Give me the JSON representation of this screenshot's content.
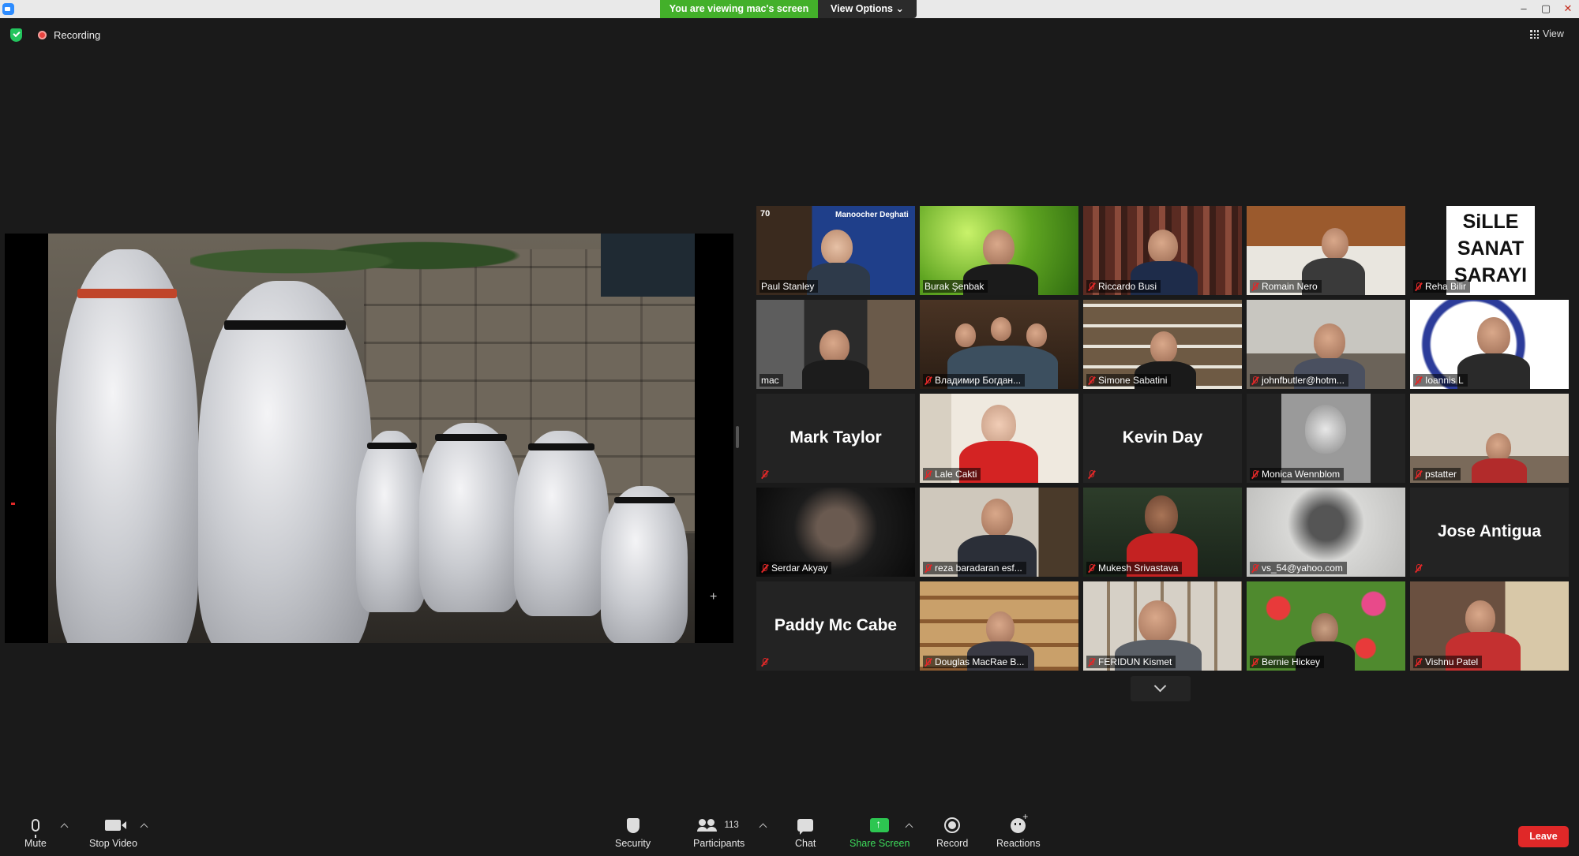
{
  "window": {
    "banner": "You are viewing mac's screen",
    "view_options": "View Options ⌄",
    "controls": [
      "–",
      "▢",
      "✕"
    ]
  },
  "meeting_bar": {
    "recording_label": "Recording",
    "view_label": "View"
  },
  "gallery": {
    "tiles": [
      {
        "name": "Paul Stanley",
        "video": true,
        "muted": false
      },
      {
        "name": "Burak Şenbak",
        "video": true,
        "muted": false
      },
      {
        "name": "Riccardo Busi",
        "video": true,
        "muted": true
      },
      {
        "name": "Romain Nero",
        "video": true,
        "muted": true
      },
      {
        "name": "Reha Bilir",
        "video": true,
        "muted": true
      },
      {
        "name": "mac",
        "video": true,
        "muted": false,
        "active": true
      },
      {
        "name": "Владимир Богдан...",
        "video": true,
        "muted": true
      },
      {
        "name": "Simone Sabatini",
        "video": true,
        "muted": true
      },
      {
        "name": "johnfbutler@hotm...",
        "video": true,
        "muted": true
      },
      {
        "name": "Ioannis L",
        "video": true,
        "muted": true
      },
      {
        "name": "Mark Taylor",
        "video": false,
        "muted": true
      },
      {
        "name": "Lale Cakti",
        "video": true,
        "muted": true
      },
      {
        "name": "Kevin Day",
        "video": false,
        "muted": true
      },
      {
        "name": "Monica Wennblom",
        "video": true,
        "muted": true
      },
      {
        "name": "pstatter",
        "video": true,
        "muted": true
      },
      {
        "name": "Serdar Akyay",
        "video": true,
        "muted": true
      },
      {
        "name": "reza baradaran esf...",
        "video": true,
        "muted": true
      },
      {
        "name": "Mukesh Srivastava",
        "video": true,
        "muted": true
      },
      {
        "name": "vs_54@yahoo.com",
        "video": true,
        "muted": true
      },
      {
        "name": "Jose Antigua",
        "video": false,
        "muted": true
      },
      {
        "name": "Paddy Mc Cabe",
        "video": false,
        "muted": true
      },
      {
        "name": "Douglas MacRae B...",
        "video": true,
        "muted": true
      },
      {
        "name": "FERIDUN Kismet",
        "video": true,
        "muted": true
      },
      {
        "name": "Bernie Hickey",
        "video": true,
        "muted": true
      },
      {
        "name": "Vishnu Patel",
        "video": true,
        "muted": true
      }
    ],
    "tile_text": {
      "paul_poster_title": "Manoocher Deghati",
      "paul_poster_number": "70",
      "sille_lines": [
        "SiLLE",
        "SANAT",
        "SARAYI"
      ]
    }
  },
  "toolbar": {
    "mute": "Mute",
    "stop_video": "Stop Video",
    "security": "Security",
    "participants": "Participants",
    "participant_count": "113",
    "chat": "Chat",
    "share_screen": "Share Screen",
    "record": "Record",
    "reactions": "Reactions",
    "leave": "Leave"
  },
  "colors": {
    "banner_green": "#43b02a",
    "active_speaker": "#e5e04a",
    "share_green": "#2dc651",
    "leave_red": "#e02828"
  }
}
